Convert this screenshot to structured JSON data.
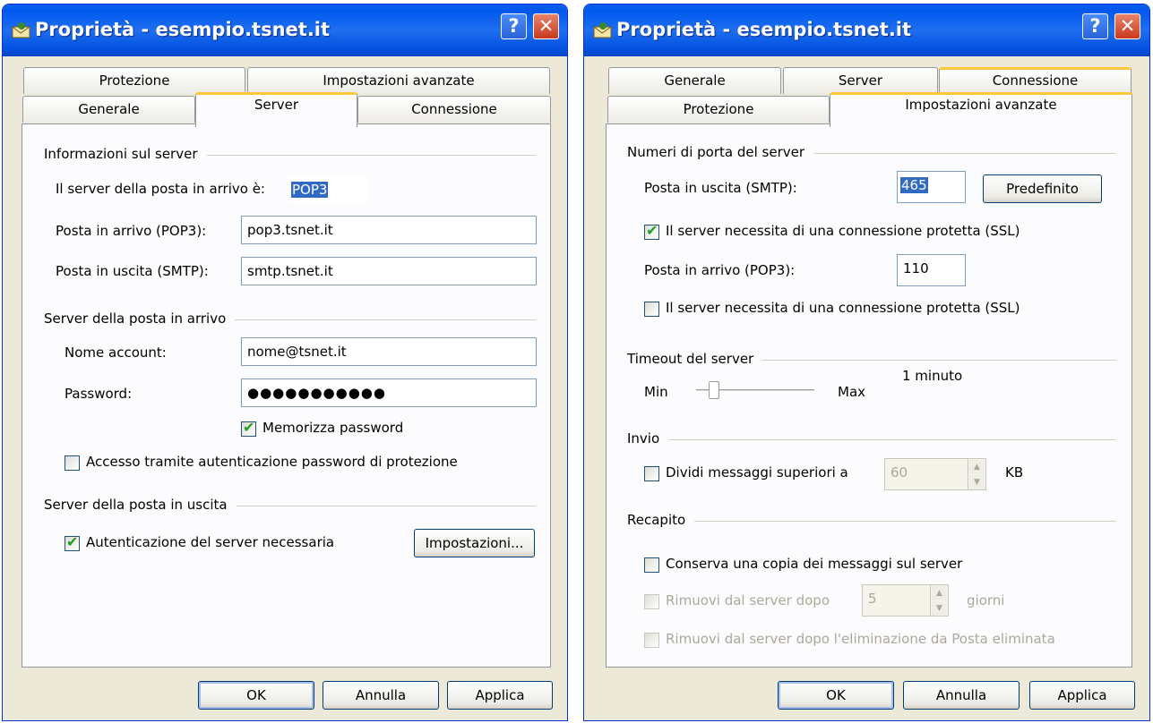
{
  "window_left": {
    "title": "Proprietà - esempio.tsnet.it",
    "help_label": "?",
    "close_label": "✕",
    "tabs": {
      "protezione": "Protezione",
      "avanzate": "Impostazioni avanzate",
      "generale": "Generale",
      "server": "Server",
      "connessione": "Connessione"
    },
    "group_info": "Informazioni sul server",
    "incoming_type_label": "Il server della posta in arrivo è:",
    "incoming_type_value": "POP3",
    "pop3_label": "Posta in arrivo (POP3):",
    "pop3_value": "pop3.tsnet.it",
    "smtp_label": "Posta in uscita (SMTP):",
    "smtp_value": "smtp.tsnet.it",
    "group_incoming": "Server della posta in arrivo",
    "account_label": "Nome account:",
    "account_value": "nome@tsnet.it",
    "password_label": "Password:",
    "password_value": "●●●●●●●●●●●",
    "remember_password": "Memorizza password",
    "spa_label": "Accesso tramite autenticazione password di protezione",
    "group_outgoing": "Server della posta in uscita",
    "auth_label": "Autenticazione del server necessaria",
    "settings_button": "Impostazioni...",
    "ok": "OK",
    "cancel": "Annulla",
    "apply": "Applica"
  },
  "window_right": {
    "title": "Proprietà - esempio.tsnet.it",
    "help_label": "?",
    "close_label": "✕",
    "tabs": {
      "generale": "Generale",
      "server": "Server",
      "connessione": "Connessione",
      "protezione": "Protezione",
      "avanzate": "Impostazioni avanzate"
    },
    "group_ports": "Numeri di porta del server",
    "smtp_label": "Posta in uscita (SMTP):",
    "smtp_port": "465",
    "default_button": "Predefinito",
    "ssl_smtp": "Il server necessita di una connessione protetta (SSL)",
    "pop3_label": "Posta in arrivo (POP3):",
    "pop3_port": "110",
    "ssl_pop3": "Il server necessita di una connessione protetta (SSL)",
    "group_timeout": "Timeout del server",
    "timeout_value": "1 minuto",
    "timeout_min": "Min",
    "timeout_max": "Max",
    "group_send": "Invio",
    "split_label": "Dividi messaggi superiori a",
    "split_value": "60",
    "split_unit": "KB",
    "group_delivery": "Recapito",
    "keep_copy": "Conserva una copia dei messaggi sul server",
    "remove_after": "Rimuovi dal server dopo",
    "remove_days": "5",
    "days_unit": "giorni",
    "remove_deleted": "Rimuovi dal server dopo l'eliminazione da Posta eliminata",
    "ok": "OK",
    "cancel": "Annulla",
    "apply": "Applica"
  }
}
